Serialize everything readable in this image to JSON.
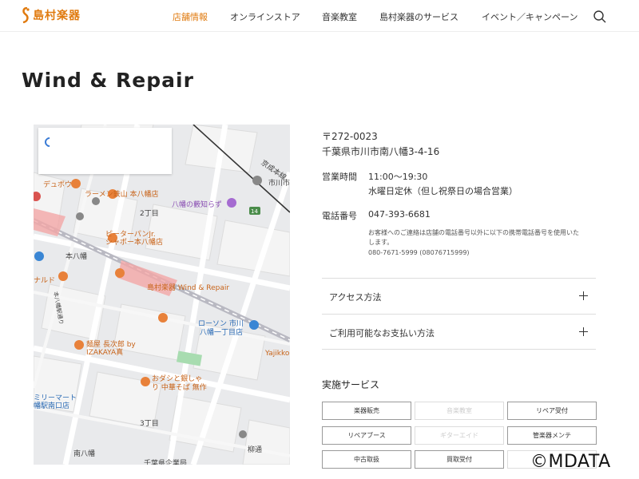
{
  "header": {
    "logo_text": "島村楽器",
    "nav": [
      {
        "label": "店舗情報",
        "active": true
      },
      {
        "label": "オンラインストア",
        "active": false
      },
      {
        "label": "音楽教室",
        "active": false
      },
      {
        "label": "島村楽器のサービス",
        "active": false
      },
      {
        "label": "イベント／キャンペーン",
        "active": false
      }
    ],
    "search_icon": "search-icon"
  },
  "page": {
    "title": "Wind & Repair"
  },
  "map": {
    "labels": [
      "ラーメン鉄山 本八幡店",
      "八幡の藪知らず",
      "2丁目",
      "ピーターパンJr.",
      "シャポー本八幡店",
      "本八幡",
      "ナルド",
      "島村楽器 Wind & Repair",
      "ローソン 市川",
      "八幡一丁目店",
      "Yajikko",
      "麺屋 長次郎 by",
      "IZAKAYA真",
      "おダシと銀しゃ",
      "り 中華そば 無作",
      "ミリーマート",
      "幡駅南口店",
      "3丁目",
      "南八幡",
      "柳通",
      "千葉県企業局",
      "市川市",
      "京成本線",
      "デュポウ",
      "本八幡駅通り"
    ],
    "route_badge": "14"
  },
  "info": {
    "postal": "〒272-0023",
    "address": "千葉県市川市南八幡3-4-16",
    "hours_label": "営業時間",
    "hours": "11:00〜19:30",
    "closed": "水曜日定休（但し祝祭日の場合営業）",
    "phone_label": "電話番号",
    "phone": "047-393-6681",
    "note_line1": "お客様へのご連絡は店舗の電話番号以外に以下の携帯電話番号を使用いた",
    "note_line2": "します。",
    "note_line3": "080-7671-5999 (08076715999)"
  },
  "accordions": [
    {
      "label": "アクセス方法"
    },
    {
      "label": "ご利用可能なお支払い方法"
    }
  ],
  "services": {
    "title": "実施サービス",
    "items": [
      {
        "label": "楽器販売",
        "enabled": true
      },
      {
        "label": "音楽教室",
        "enabled": false
      },
      {
        "label": "リペア受付",
        "enabled": true
      },
      {
        "label": "リペアブース",
        "enabled": true
      },
      {
        "label": "ギターエイド",
        "enabled": false
      },
      {
        "label": "管楽器メンテ",
        "enabled": true
      },
      {
        "label": "中古取扱",
        "enabled": true
      },
      {
        "label": "買取受付",
        "enabled": true
      },
      {
        "label": "",
        "enabled": false
      }
    ]
  },
  "watermark": "©MDATA",
  "colors": {
    "accent": "#e07b10",
    "rail": "#d9534f",
    "map_bg": "#e9eaec"
  }
}
